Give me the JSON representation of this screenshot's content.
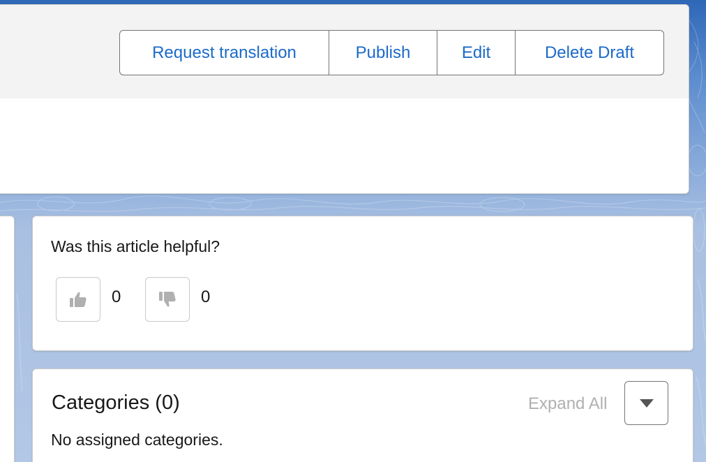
{
  "header": {
    "actions": {
      "request_translation": "Request translation",
      "publish": "Publish",
      "edit": "Edit",
      "delete_draft": "Delete Draft"
    }
  },
  "helpful": {
    "question": "Was this article helpful?",
    "up_count": "0",
    "down_count": "0",
    "up_icon": "thumbs-up-icon",
    "down_icon": "thumbs-down-icon"
  },
  "categories": {
    "title": "Categories (0)",
    "empty_text": "No assigned categories.",
    "expand_all": "Expand All",
    "dropdown_icon": "chevron-down-icon"
  },
  "colors": {
    "action_text": "#1b6ac9",
    "body_text": "#181818",
    "disabled_text": "#b0b0b0",
    "border": "#c9c9c9",
    "band": "#f3f3f3"
  }
}
